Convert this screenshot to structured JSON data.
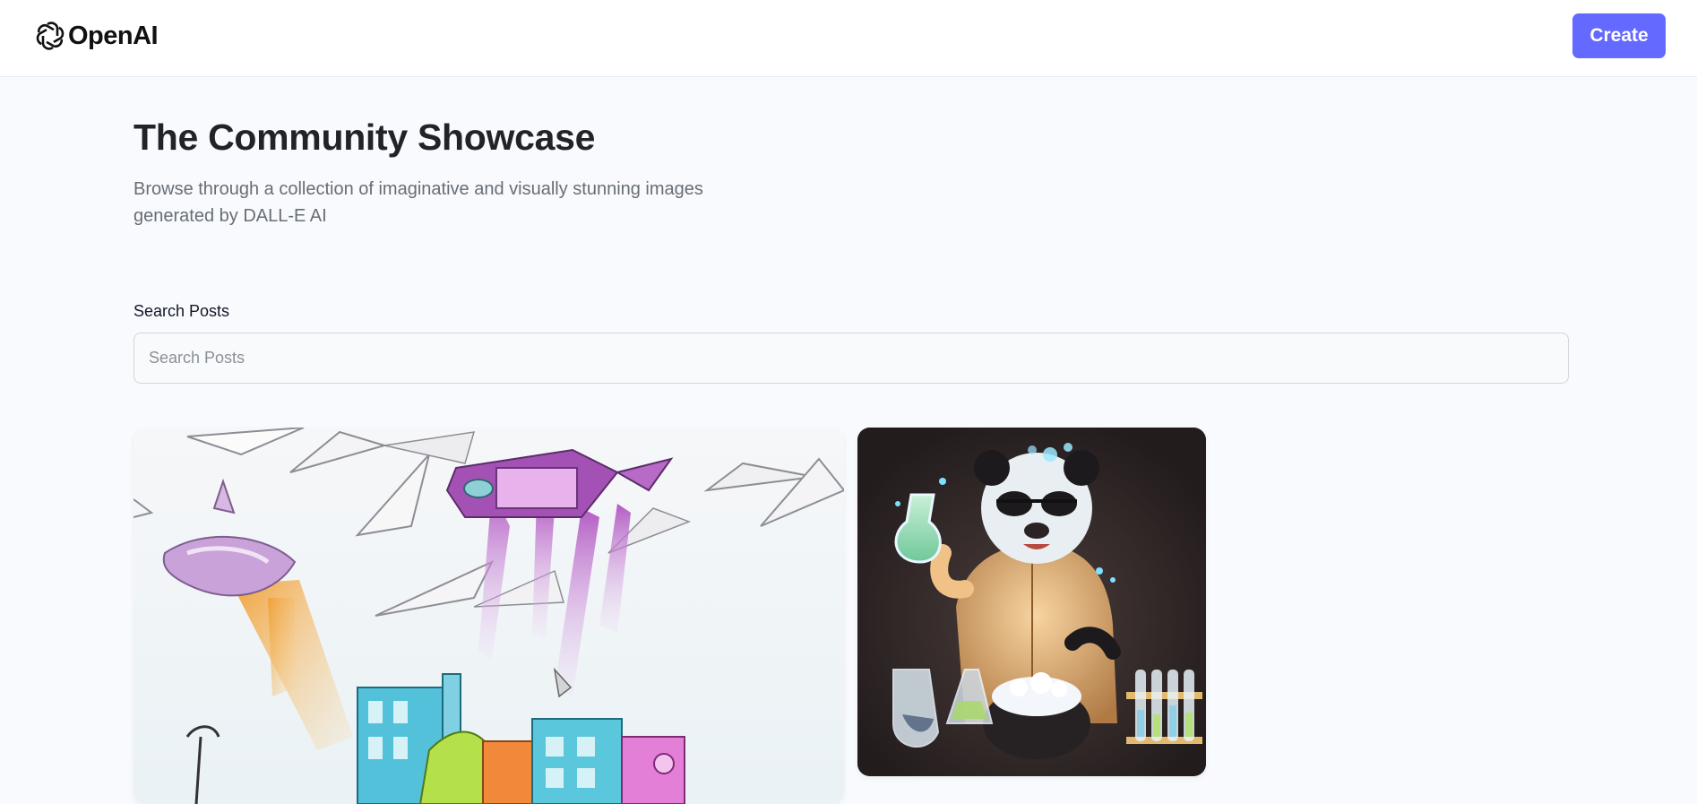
{
  "header": {
    "logo_text": "OpenAI",
    "logo_icon": "openai-logo-icon",
    "create_label": "Create"
  },
  "main": {
    "title": "The Community Showcase",
    "subtitle": "Browse through a collection of imaginative and visually stunning images generated by DALL-E AI"
  },
  "search": {
    "label": "Search Posts",
    "placeholder": "Search Posts",
    "value": ""
  },
  "colors": {
    "accent": "#6469ff",
    "title": "#222328",
    "subtitle": "#666e75",
    "background": "#f9fafe"
  },
  "posts": [
    {
      "image": "watercolor-flying-ships-over-city"
    },
    {
      "image": "panda-scientist-with-lab-flasks"
    }
  ]
}
